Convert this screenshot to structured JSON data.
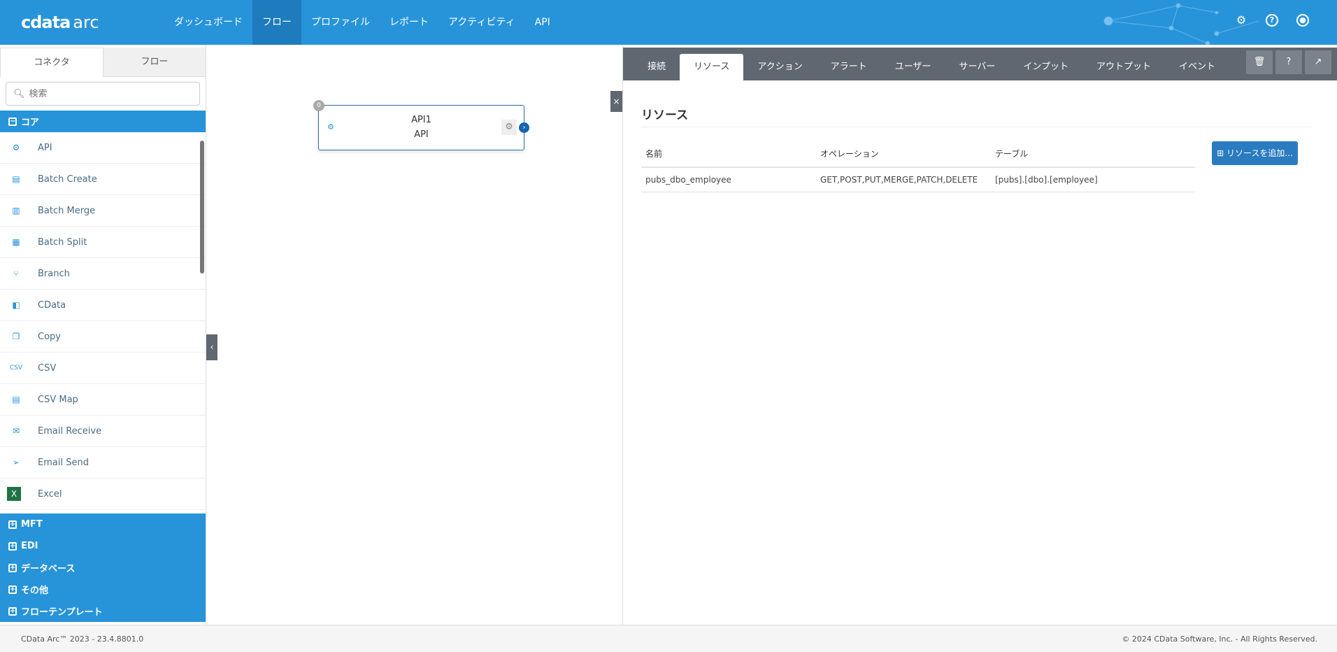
{
  "header": {
    "logo": "cdata",
    "logo_suffix": "arc",
    "nav": [
      "ダッシュボード",
      "フロー",
      "プロファイル",
      "レポート",
      "アクティビティ",
      "API"
    ],
    "active_nav": "フロー",
    "icons": [
      "gear-icon",
      "help-icon",
      "user-icon"
    ]
  },
  "sidebar": {
    "tabs": [
      "コネクタ",
      "フロー"
    ],
    "search_placeholder": "検索",
    "core_group": "コア",
    "items": [
      {
        "label": "API",
        "icon": "api-icon"
      },
      {
        "label": "Batch Create",
        "icon": "batch-create-icon"
      },
      {
        "label": "Batch Merge",
        "icon": "batch-merge-icon"
      },
      {
        "label": "Batch Split",
        "icon": "batch-split-icon"
      },
      {
        "label": "Branch",
        "icon": "branch-icon"
      },
      {
        "label": "CData",
        "icon": "cdata-icon"
      },
      {
        "label": "Copy",
        "icon": "copy-icon"
      },
      {
        "label": "CSV",
        "icon": "csv-icon"
      },
      {
        "label": "CSV Map",
        "icon": "csv-map-icon"
      },
      {
        "label": "Email Receive",
        "icon": "email-receive-icon"
      },
      {
        "label": "Email Send",
        "icon": "email-send-icon"
      },
      {
        "label": "Excel",
        "icon": "excel-icon"
      }
    ],
    "groups": [
      "MFT",
      "EDI",
      "データベース",
      "その他",
      "フローテンプレート"
    ]
  },
  "canvas": {
    "node": {
      "title": "API1",
      "type": "API",
      "badge": "0"
    }
  },
  "panel": {
    "tabs": [
      "接続",
      "リソース",
      "アクション",
      "アラート",
      "ユーザー",
      "サーバー",
      "インプット",
      "アウトプット",
      "イベント"
    ],
    "active_tab": "リソース",
    "title": "リソース",
    "columns": [
      "名前",
      "オペレーション",
      "テーブル"
    ],
    "rows": [
      [
        "pubs_dbo_employee",
        "GET,POST,PUT,MERGE,PATCH,DELETE",
        "[pubs].[dbo].[employee]"
      ]
    ],
    "add_button": "リソースを追加..."
  },
  "footer": {
    "version": "CData Arc™ 2023 - 23.4.8801.0",
    "copyright": "© 2024 CData Software, Inc. - All Rights Reserved."
  },
  "colors": {
    "brand": "#2794da",
    "tab_bar": "#5f6770",
    "button": "#2b7bc0"
  }
}
